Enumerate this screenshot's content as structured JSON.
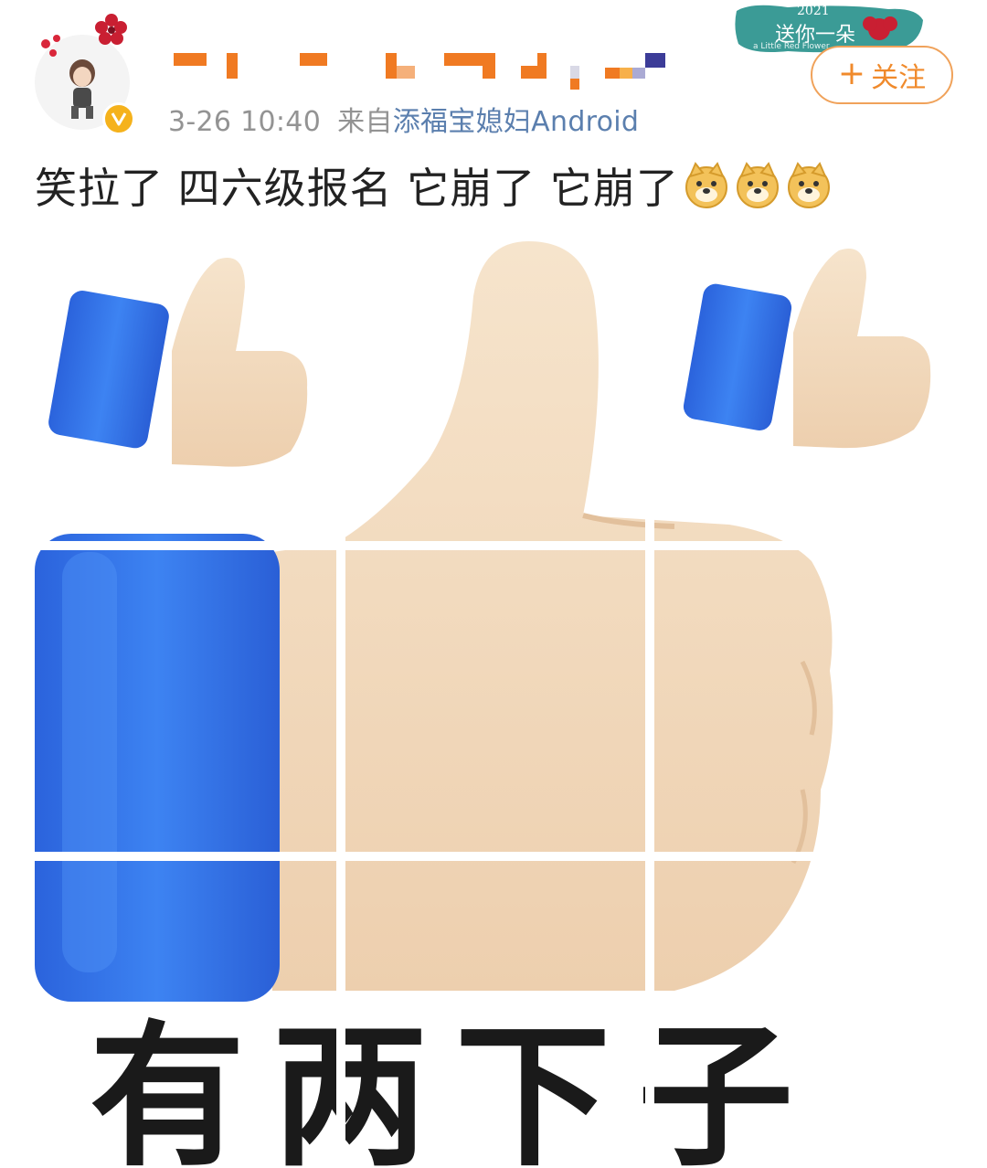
{
  "post": {
    "timestamp": "3-26 10:40",
    "from_label": "来自",
    "source": "添福宝媳妇Android",
    "text": "笑拉了 四六级报名 它崩了 它崩了",
    "emoji_count": 3
  },
  "follow_button": {
    "plus": "+",
    "label": "关注"
  },
  "badge": {
    "year": "2021",
    "text": "送你一朵",
    "subtext": "a Little Red Flower"
  },
  "image": {
    "caption": "有两下子",
    "grid_rows": 3,
    "grid_cols": 3
  },
  "colors": {
    "follow_orange": "#f08a2b",
    "source_link": "#5b7fae",
    "meta_gray": "#939393",
    "verified_gold": "#f5b21c",
    "thumb_skin": "#f3dcc2",
    "cuff_blue": "#2f6ee0"
  },
  "icons": [
    "verified-badge-icon",
    "doge-emoji-icon",
    "thumbs-up-icon",
    "red-flower-icon"
  ]
}
